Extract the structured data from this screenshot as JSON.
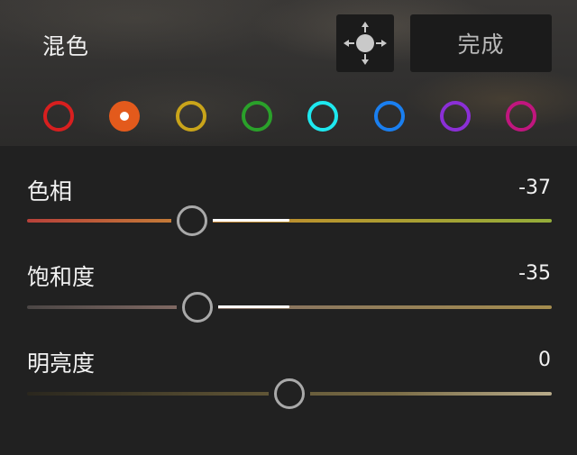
{
  "header": {
    "title": "混色",
    "done_label": "完成",
    "target_tool_icon": "target-adjust-icon"
  },
  "swatches": [
    {
      "name": "red",
      "color": "#d81f1f",
      "selected": false
    },
    {
      "name": "orange",
      "color": "#e35a1c",
      "selected": true
    },
    {
      "name": "yellow",
      "color": "#c9a41a",
      "selected": false
    },
    {
      "name": "green",
      "color": "#2aa12a",
      "selected": false
    },
    {
      "name": "aqua",
      "color": "#1ee8ef",
      "selected": false
    },
    {
      "name": "blue",
      "color": "#1a7ff0",
      "selected": false
    },
    {
      "name": "purple",
      "color": "#8b2fd6",
      "selected": false
    },
    {
      "name": "magenta",
      "color": "#c0167e",
      "selected": false
    }
  ],
  "sliders": {
    "hue": {
      "label": "色相",
      "value": "-37",
      "min": -100,
      "max": 100,
      "level": -37
    },
    "saturation": {
      "label": "饱和度",
      "value": "-35",
      "min": -100,
      "max": 100,
      "level": -35
    },
    "luminance": {
      "label": "明亮度",
      "value": "0",
      "min": -100,
      "max": 100,
      "level": 0
    }
  }
}
